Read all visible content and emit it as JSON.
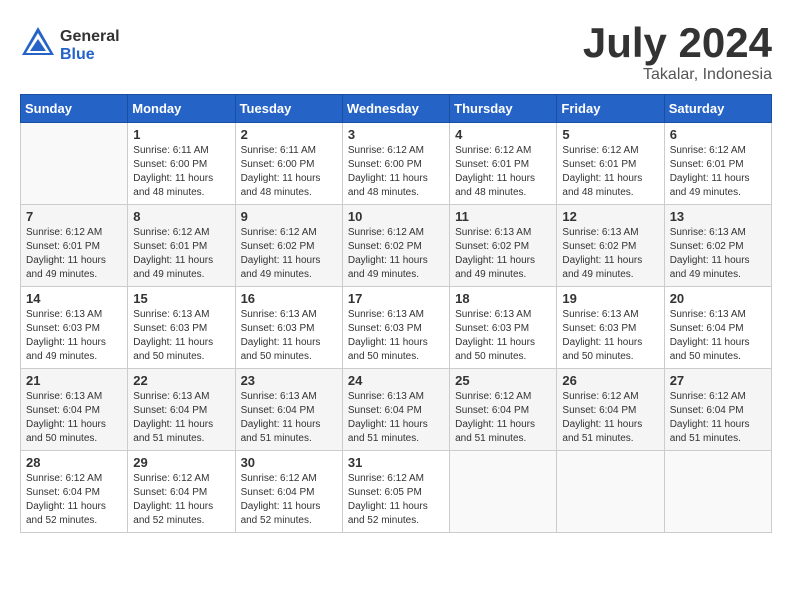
{
  "header": {
    "logo_general": "General",
    "logo_blue": "Blue",
    "title": "July 2024",
    "subtitle": "Takalar, Indonesia"
  },
  "calendar": {
    "weekdays": [
      "Sunday",
      "Monday",
      "Tuesday",
      "Wednesday",
      "Thursday",
      "Friday",
      "Saturday"
    ],
    "weeks": [
      [
        {
          "day": "",
          "info": ""
        },
        {
          "day": "1",
          "info": "Sunrise: 6:11 AM\nSunset: 6:00 PM\nDaylight: 11 hours\nand 48 minutes."
        },
        {
          "day": "2",
          "info": "Sunrise: 6:11 AM\nSunset: 6:00 PM\nDaylight: 11 hours\nand 48 minutes."
        },
        {
          "day": "3",
          "info": "Sunrise: 6:12 AM\nSunset: 6:00 PM\nDaylight: 11 hours\nand 48 minutes."
        },
        {
          "day": "4",
          "info": "Sunrise: 6:12 AM\nSunset: 6:01 PM\nDaylight: 11 hours\nand 48 minutes."
        },
        {
          "day": "5",
          "info": "Sunrise: 6:12 AM\nSunset: 6:01 PM\nDaylight: 11 hours\nand 48 minutes."
        },
        {
          "day": "6",
          "info": "Sunrise: 6:12 AM\nSunset: 6:01 PM\nDaylight: 11 hours\nand 49 minutes."
        }
      ],
      [
        {
          "day": "7",
          "info": "Sunrise: 6:12 AM\nSunset: 6:01 PM\nDaylight: 11 hours\nand 49 minutes."
        },
        {
          "day": "8",
          "info": "Sunrise: 6:12 AM\nSunset: 6:01 PM\nDaylight: 11 hours\nand 49 minutes."
        },
        {
          "day": "9",
          "info": "Sunrise: 6:12 AM\nSunset: 6:02 PM\nDaylight: 11 hours\nand 49 minutes."
        },
        {
          "day": "10",
          "info": "Sunrise: 6:12 AM\nSunset: 6:02 PM\nDaylight: 11 hours\nand 49 minutes."
        },
        {
          "day": "11",
          "info": "Sunrise: 6:13 AM\nSunset: 6:02 PM\nDaylight: 11 hours\nand 49 minutes."
        },
        {
          "day": "12",
          "info": "Sunrise: 6:13 AM\nSunset: 6:02 PM\nDaylight: 11 hours\nand 49 minutes."
        },
        {
          "day": "13",
          "info": "Sunrise: 6:13 AM\nSunset: 6:02 PM\nDaylight: 11 hours\nand 49 minutes."
        }
      ],
      [
        {
          "day": "14",
          "info": "Sunrise: 6:13 AM\nSunset: 6:03 PM\nDaylight: 11 hours\nand 49 minutes."
        },
        {
          "day": "15",
          "info": "Sunrise: 6:13 AM\nSunset: 6:03 PM\nDaylight: 11 hours\nand 50 minutes."
        },
        {
          "day": "16",
          "info": "Sunrise: 6:13 AM\nSunset: 6:03 PM\nDaylight: 11 hours\nand 50 minutes."
        },
        {
          "day": "17",
          "info": "Sunrise: 6:13 AM\nSunset: 6:03 PM\nDaylight: 11 hours\nand 50 minutes."
        },
        {
          "day": "18",
          "info": "Sunrise: 6:13 AM\nSunset: 6:03 PM\nDaylight: 11 hours\nand 50 minutes."
        },
        {
          "day": "19",
          "info": "Sunrise: 6:13 AM\nSunset: 6:03 PM\nDaylight: 11 hours\nand 50 minutes."
        },
        {
          "day": "20",
          "info": "Sunrise: 6:13 AM\nSunset: 6:04 PM\nDaylight: 11 hours\nand 50 minutes."
        }
      ],
      [
        {
          "day": "21",
          "info": "Sunrise: 6:13 AM\nSunset: 6:04 PM\nDaylight: 11 hours\nand 50 minutes."
        },
        {
          "day": "22",
          "info": "Sunrise: 6:13 AM\nSunset: 6:04 PM\nDaylight: 11 hours\nand 51 minutes."
        },
        {
          "day": "23",
          "info": "Sunrise: 6:13 AM\nSunset: 6:04 PM\nDaylight: 11 hours\nand 51 minutes."
        },
        {
          "day": "24",
          "info": "Sunrise: 6:13 AM\nSunset: 6:04 PM\nDaylight: 11 hours\nand 51 minutes."
        },
        {
          "day": "25",
          "info": "Sunrise: 6:12 AM\nSunset: 6:04 PM\nDaylight: 11 hours\nand 51 minutes."
        },
        {
          "day": "26",
          "info": "Sunrise: 6:12 AM\nSunset: 6:04 PM\nDaylight: 11 hours\nand 51 minutes."
        },
        {
          "day": "27",
          "info": "Sunrise: 6:12 AM\nSunset: 6:04 PM\nDaylight: 11 hours\nand 51 minutes."
        }
      ],
      [
        {
          "day": "28",
          "info": "Sunrise: 6:12 AM\nSunset: 6:04 PM\nDaylight: 11 hours\nand 52 minutes."
        },
        {
          "day": "29",
          "info": "Sunrise: 6:12 AM\nSunset: 6:04 PM\nDaylight: 11 hours\nand 52 minutes."
        },
        {
          "day": "30",
          "info": "Sunrise: 6:12 AM\nSunset: 6:04 PM\nDaylight: 11 hours\nand 52 minutes."
        },
        {
          "day": "31",
          "info": "Sunrise: 6:12 AM\nSunset: 6:05 PM\nDaylight: 11 hours\nand 52 minutes."
        },
        {
          "day": "",
          "info": ""
        },
        {
          "day": "",
          "info": ""
        },
        {
          "day": "",
          "info": ""
        }
      ]
    ]
  }
}
